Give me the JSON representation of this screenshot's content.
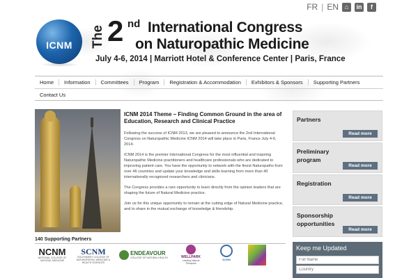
{
  "topbar": {
    "lang_fr": "FR",
    "lang_sep": "|",
    "lang_en": "EN",
    "icons": [
      "home-icon",
      "linkedin-icon",
      "facebook-icon"
    ]
  },
  "header": {
    "logo_text": "ICNM",
    "the": "The",
    "ordinal_number": "2",
    "ordinal_suffix": "nd",
    "title_line1": "International Congress",
    "title_line2": "on Naturopathic Medicine",
    "subtitle": "July 4-6, 2014 | Marriott Hotel & Conference Center | Paris, France"
  },
  "nav": {
    "row1": [
      "Home",
      "Information",
      "Committees",
      "Program",
      "Registration & Accommodation",
      "Exhibitors & Sponsors",
      "Supporting Partners"
    ],
    "row2": [
      "Contact Us"
    ]
  },
  "article": {
    "title": "ICNM 2014 Theme – Finding Common Ground in the area of Education, Research and Clinical Practice",
    "p1": "Following the success of ICNM 2013, we are pleased to announce the 2nd International Congress on Naturopathic Medicine ICNM 2014 will take place in Paris, France July 4-6, 2014.",
    "p2": "ICNM 2014 is the premier International Congress for the most influential and inspiring Naturopathic Medicine practitioners and healthcare professionals who are dedicated to improving patient care. You have the opportunity to network with the finest Naturopaths from over 46 countries and update your knowledge and skills learning from more than 40 internationally recognized researchers and clinicians.",
    "p3": "The Congress provides a rare opportunity to learn directly from the opinion leaders that are shaping the future of Natural Medicine practice.",
    "p4": "Join us for this unique opportunity to remain at the cutting edge of Natural Medicine practice, and to share in the mutual exchange of knowledge & friendship."
  },
  "sidebar": {
    "boxes": [
      {
        "label": "Partners",
        "button": "Read more"
      },
      {
        "label": "Preliminary program",
        "button": "Read more"
      },
      {
        "label": "Registration",
        "button": "Read more"
      },
      {
        "label": "Sponsorship opportunities",
        "button": "Read more"
      }
    ]
  },
  "partners": {
    "heading": "140 Supporting Partners",
    "logos": [
      {
        "name": "NCNM",
        "sub": "NATIONAL COLLEGE OF NATURAL MEDICINE"
      },
      {
        "name": "SCNM",
        "sub": "SOUTHWEST COLLEGE OF NATUROPATHIC MEDICINE & HEALTH SCIENCES"
      },
      {
        "name": "ENDEAVOUR",
        "sub": "COLLEGE OF NATURAL HEALTH"
      },
      {
        "name": "WELLPARK",
        "sub": "Leading Natural Therapies"
      },
      {
        "name": "GCRN",
        "sub": ""
      }
    ]
  },
  "newsletter": {
    "title": "Keep me Updated",
    "full_name_placeholder": "Full Name",
    "country_placeholder": "Country"
  }
}
